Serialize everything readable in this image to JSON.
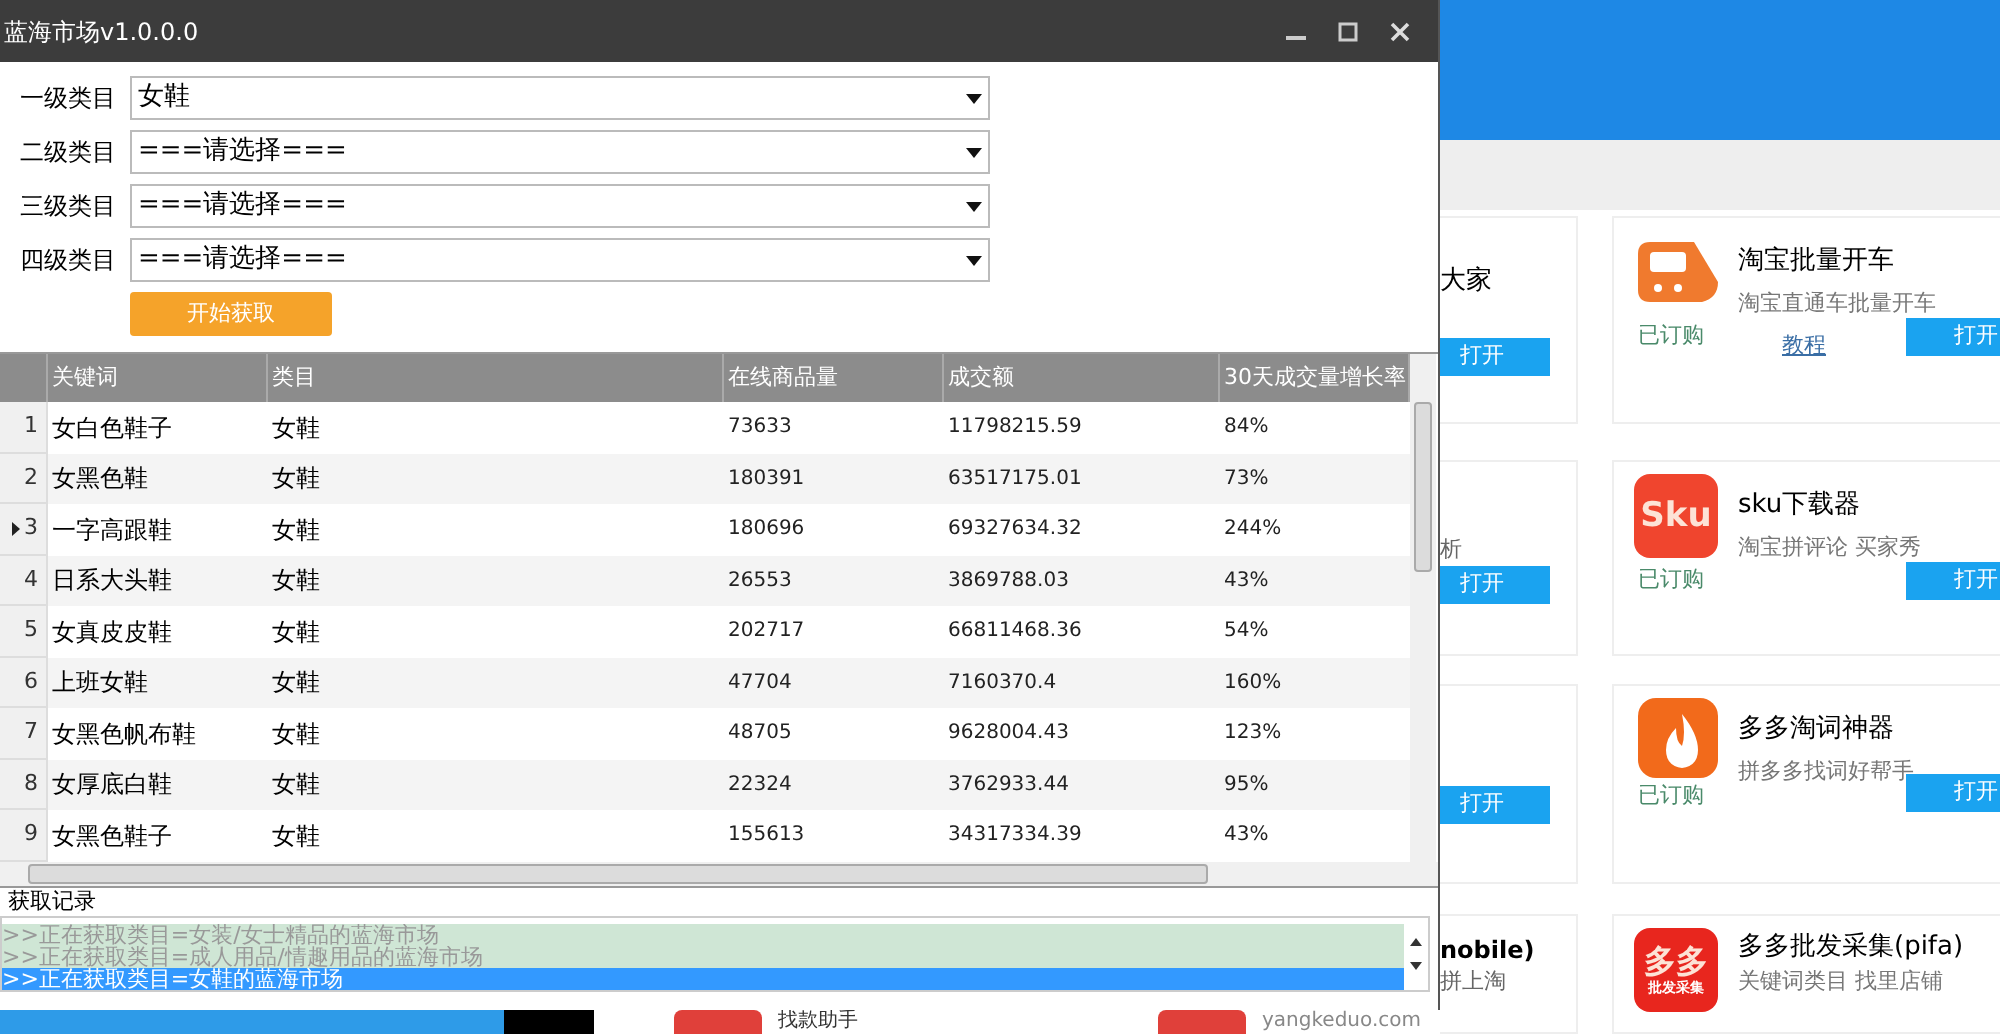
{
  "window": {
    "title": "蓝海市场v1.0.0.0"
  },
  "filters": [
    {
      "label": "一级类目",
      "value": "女鞋"
    },
    {
      "label": "二级类目",
      "value": "===请选择==="
    },
    {
      "label": "三级类目",
      "value": "===请选择==="
    },
    {
      "label": "四级类目",
      "value": "===请选择==="
    }
  ],
  "start_button": "开始获取",
  "table": {
    "columns": [
      "关键词",
      "类目",
      "在线商品量",
      "成交额",
      "30天成交量增长率"
    ],
    "rows": [
      {
        "index": "1",
        "selected": false,
        "cells": [
          "女白色鞋子",
          "女鞋",
          "73633",
          "11798215.59",
          "84%"
        ]
      },
      {
        "index": "2",
        "selected": false,
        "cells": [
          "女黑色鞋",
          "女鞋",
          "180391",
          "63517175.01",
          "73%"
        ]
      },
      {
        "index": "3",
        "selected": true,
        "cells": [
          "一字高跟鞋",
          "女鞋",
          "180696",
          "69327634.32",
          "244%"
        ]
      },
      {
        "index": "4",
        "selected": false,
        "cells": [
          "日系大头鞋",
          "女鞋",
          "26553",
          "3869788.03",
          "43%"
        ]
      },
      {
        "index": "5",
        "selected": false,
        "cells": [
          "女真皮皮鞋",
          "女鞋",
          "202717",
          "66811468.36",
          "54%"
        ]
      },
      {
        "index": "6",
        "selected": false,
        "cells": [
          "上班女鞋",
          "女鞋",
          "47704",
          "7160370.4",
          "160%"
        ]
      },
      {
        "index": "7",
        "selected": false,
        "cells": [
          "女黑色帆布鞋",
          "女鞋",
          "48705",
          "9628004.43",
          "123%"
        ]
      },
      {
        "index": "8",
        "selected": false,
        "cells": [
          "女厚底白鞋",
          "女鞋",
          "22324",
          "3762933.44",
          "95%"
        ]
      },
      {
        "index": "9",
        "selected": false,
        "cells": [
          "女黑色鞋子",
          "女鞋",
          "155613",
          "34317334.39",
          "43%"
        ]
      }
    ]
  },
  "log": {
    "label": "获取记录",
    "lines": [
      {
        "text": ">>正在获取类目=女装/女士精品的蓝海市场",
        "selected": false
      },
      {
        "text": ">>正在获取类目=成人用品/情趣用品的蓝海市场",
        "selected": false
      },
      {
        "text": ">>正在获取类目=女鞋的蓝海市场",
        "selected": true
      }
    ]
  },
  "background_page": {
    "left_cards": [
      {
        "title": "大家",
        "button": "打开"
      },
      {
        "subtitle": "析",
        "button": "打开"
      },
      {
        "button": "打开"
      },
      {
        "title": "nobile)",
        "subtitle": "拼上淘"
      }
    ],
    "cards": [
      {
        "kind": "train",
        "title": "淘宝批量开车",
        "subtitle": "淘宝直通车批量开车",
        "status": "已订购",
        "link": "教程",
        "button": "打开"
      },
      {
        "kind": "text",
        "logo_text": "Sku",
        "title": "sku下载器",
        "subtitle": "淘宝拼评论 买家秀",
        "status": "已订购",
        "button": "打开"
      },
      {
        "kind": "flame",
        "title": "多多淘词神器",
        "subtitle": "拼多多找词好帮手",
        "status": "已订购",
        "button": "打开"
      },
      {
        "kind": "stack",
        "logo_text": "多多",
        "logo_subtext": "批发采集",
        "title": "多多批发采集(pifa)",
        "subtitle": "关键词类目 找里店铺"
      }
    ],
    "bottom_items": [
      "找款助手",
      "yangkeduo.com"
    ]
  }
}
